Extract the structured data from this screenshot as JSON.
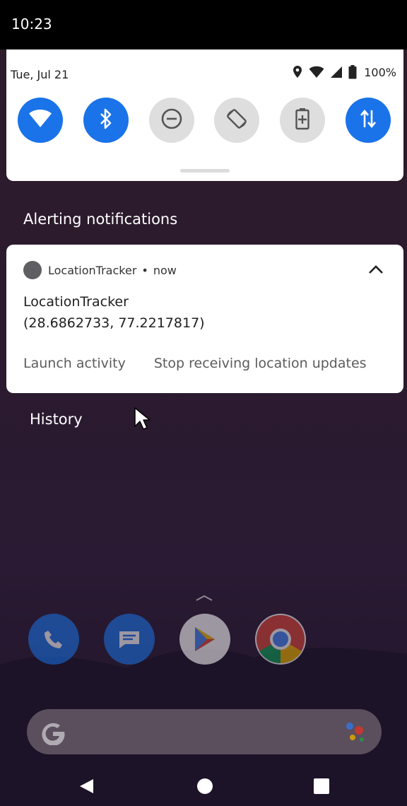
{
  "status_bar": {
    "time": "10:23"
  },
  "quick_settings": {
    "date": "Tue, Jul 21",
    "battery_percent": "100%",
    "accent_color": "#1a73e8",
    "tiles": [
      {
        "name": "wifi",
        "state": "on"
      },
      {
        "name": "bluetooth",
        "state": "on"
      },
      {
        "name": "do-not-disturb",
        "state": "off"
      },
      {
        "name": "auto-rotate",
        "state": "off"
      },
      {
        "name": "battery-saver",
        "state": "off"
      },
      {
        "name": "mobile-data",
        "state": "on"
      }
    ]
  },
  "alerting": {
    "label": "Alerting notifications"
  },
  "notification": {
    "app_name": "LocationTracker",
    "separator": "•",
    "time": "now",
    "title": "LocationTracker",
    "text": "(28.6862733, 77.2217817)",
    "actions": [
      "Launch activity",
      "Stop receiving location updates"
    ]
  },
  "history": {
    "label": "History"
  }
}
